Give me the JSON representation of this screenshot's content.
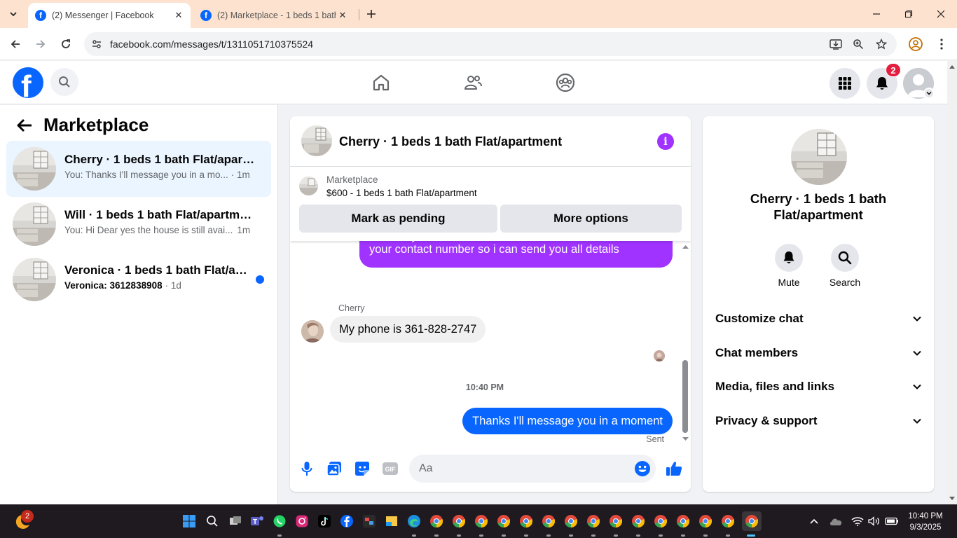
{
  "browser": {
    "tabs": [
      {
        "title": "(2) Messenger | Facebook",
        "active": true
      },
      {
        "title": "(2) Marketplace - 1 beds 1 bath",
        "active": false
      }
    ],
    "url": "facebook.com/messages/t/1311051710375524"
  },
  "facebook": {
    "notification_count": "2"
  },
  "sidebar": {
    "title": "Marketplace",
    "conversations": [
      {
        "name": "Cherry · 1 beds 1 bath Flat/apartm...",
        "preview": "You: Thanks I'll message you in a mo...",
        "time": "· 1m",
        "active": true,
        "unread": false
      },
      {
        "name": "Will · 1 beds 1 bath Flat/apartment",
        "preview": "You: Hi Dear yes the house is still avai...",
        "time": "1m",
        "active": false,
        "unread": false
      },
      {
        "name": "Veronica · 1 beds 1 bath Flat/apar...",
        "preview": "Veronica: 3612838908",
        "time": "· 1d",
        "active": false,
        "unread": true
      }
    ]
  },
  "chat": {
    "title": "Cherry · 1 beds 1 bath Flat/apartment",
    "listing": {
      "label": "Marketplace",
      "price_title": "$600 - 1 beds 1 bath Flat/apartment",
      "mark_pending": "Mark as pending",
      "more_options": "More options"
    },
    "messages": {
      "outgoing_partial_line1": "Hi Dear yes the house is still available for rent, send me",
      "outgoing_partial_line2": "your contact number so i can send you all details",
      "incoming_sender": "Cherry",
      "incoming_text": "My phone is 361-828-2747",
      "timestamp": "10:40 PM",
      "outgoing_text": "Thanks I'll message you in a moment",
      "status": "Sent"
    },
    "composer_placeholder": "Aa"
  },
  "info_panel": {
    "name": "Cherry · 1 beds 1 bath Flat/apartment",
    "actions": {
      "mute": "Mute",
      "search": "Search"
    },
    "sections": [
      "Customize chat",
      "Chat members",
      "Media, files and links",
      "Privacy & support"
    ]
  },
  "taskbar": {
    "badge": "2",
    "time": "10:40 PM",
    "date": "9/3/2025"
  },
  "colors": {
    "facebook_blue": "#0866ff",
    "messenger_purple": "#a033ff",
    "active_conversation_bg": "#ebf5ff"
  }
}
